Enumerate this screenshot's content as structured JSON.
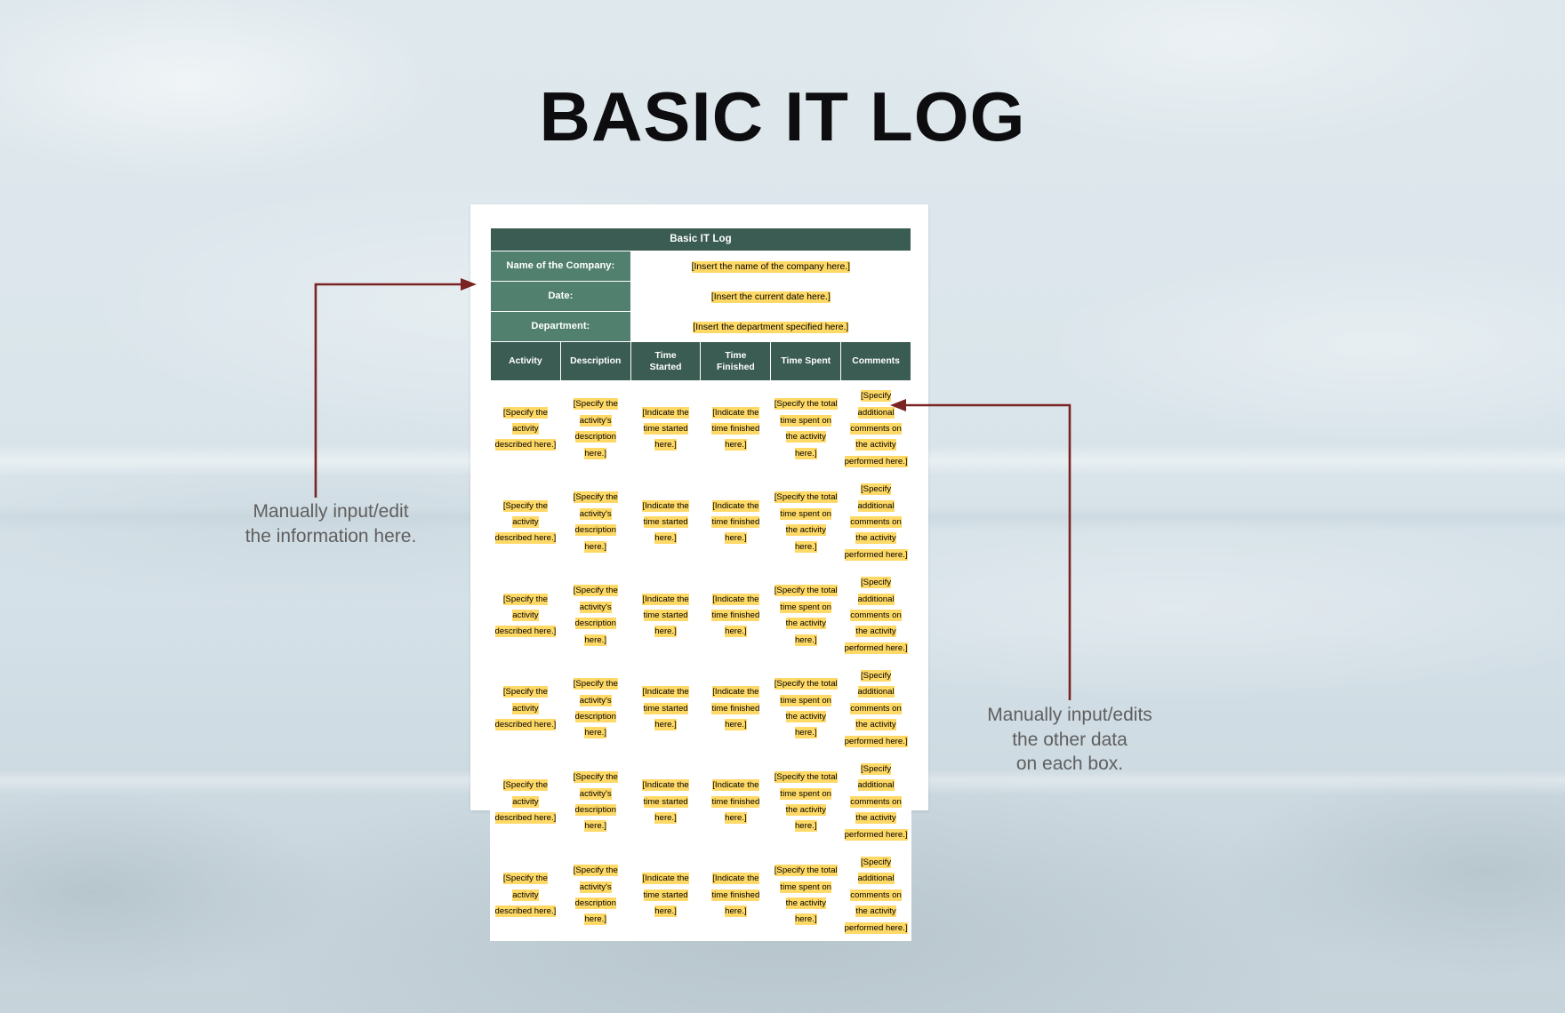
{
  "page": {
    "title": "BASIC IT LOG",
    "background_color": "#dde7ec",
    "accent_dark": "#3b5c52",
    "accent_mid": "#51806f",
    "highlight_color": "#ffd966",
    "arrow_color": "#7b2222"
  },
  "document": {
    "table_title": "Basic IT Log",
    "info_rows": [
      {
        "label": "Name of the Company:",
        "value": "[Insert the name of the company here.]"
      },
      {
        "label": "Date:",
        "value": "[Insert the current date here.]"
      },
      {
        "label": "Department:",
        "value": "[Insert the department specified here.]"
      }
    ],
    "columns": [
      {
        "label": "Activity",
        "line1": "Activity",
        "line2": ""
      },
      {
        "label": "Description",
        "line1": "Description",
        "line2": ""
      },
      {
        "label": "Time Started",
        "line1": "Time",
        "line2": "Started"
      },
      {
        "label": "Time Finished",
        "line1": "Time",
        "line2": "Finished"
      },
      {
        "label": "Time Spent",
        "line1": "Time Spent",
        "line2": ""
      },
      {
        "label": "Comments",
        "line1": "Comments",
        "line2": ""
      }
    ],
    "row_template": [
      "[Specify the activity described here.]",
      "[Specify the activity's description here.]",
      "[Indicate the time started here.]",
      "[Indicate the time finished here.]",
      "[Specify the total time spent on the activity here.]",
      "[Specify additional comments on the activity performed here.]"
    ],
    "row_count": 6
  },
  "annotations": {
    "left": "Manually input/edit\nthe information here.",
    "left_line1": "Manually input/edit",
    "left_line2": "the information here.",
    "right_line1": "Manually input/edits",
    "right_line2": "the other data",
    "right_line3": "on each box."
  }
}
